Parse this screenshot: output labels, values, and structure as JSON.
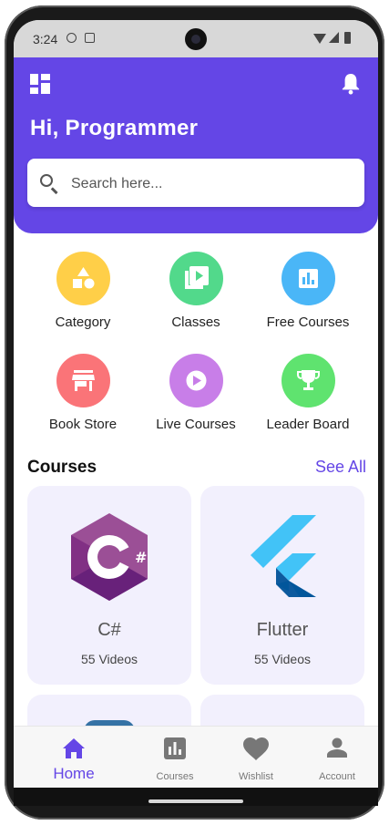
{
  "status_bar": {
    "time": "3:24"
  },
  "header": {
    "greeting": "Hi, Programmer",
    "search_placeholder": "Search here..."
  },
  "categories": [
    {
      "label": "Category",
      "icon": "shapes-icon",
      "color": "#ffcf48"
    },
    {
      "label": "Classes",
      "icon": "video-library-icon",
      "color": "#52d98b"
    },
    {
      "label": "Free Courses",
      "icon": "bar-chart-icon",
      "color": "#4ab6f7"
    },
    {
      "label": "Book Store",
      "icon": "store-icon",
      "color": "#fa7478"
    },
    {
      "label": "Live Courses",
      "icon": "play-circle-icon",
      "color": "#c87ee8"
    },
    {
      "label": "Leader Board",
      "icon": "trophy-icon",
      "color": "#5fe36f"
    }
  ],
  "courses_section": {
    "title": "Courses",
    "see_all": "See All"
  },
  "courses": [
    {
      "title": "C#",
      "videos": "55 Videos",
      "icon": "csharp-logo"
    },
    {
      "title": "Flutter",
      "videos": "55 Videos",
      "icon": "flutter-logo"
    }
  ],
  "bottom_nav": [
    {
      "label": "Home",
      "icon": "home-icon",
      "active": true
    },
    {
      "label": "Courses",
      "icon": "courses-chart-icon",
      "active": false
    },
    {
      "label": "Wishlist",
      "icon": "heart-icon",
      "active": false
    },
    {
      "label": "Account",
      "icon": "person-icon",
      "active": false
    }
  ],
  "colors": {
    "primary": "#6446e6",
    "card_bg": "#f2f0fd",
    "inactive_nav": "#777777"
  }
}
